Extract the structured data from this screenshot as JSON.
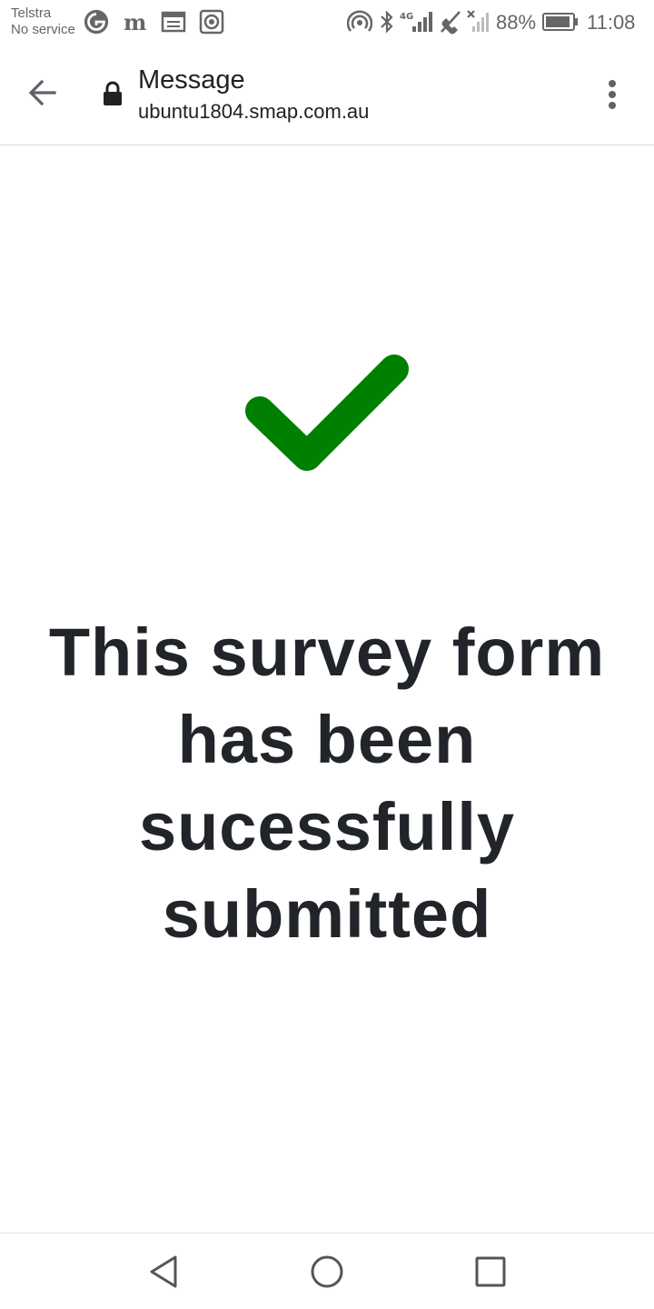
{
  "status_bar": {
    "carrier_name": "Telstra",
    "carrier_status": "No service",
    "network_type": "4G",
    "battery_percent": "88%",
    "time": "11:08",
    "icons": [
      "g-circle-icon",
      "newspaper-m-icon",
      "calendar-icon",
      "record-icon",
      "hotspot-icon",
      "bluetooth-icon",
      "signal-icon",
      "no-call-icon",
      "no-signal-icon",
      "battery-icon"
    ]
  },
  "app_bar": {
    "title": "Message",
    "url": "ubuntu1804.smap.com.au"
  },
  "content": {
    "message": "This survey form has been sucessfully submitted",
    "check_color": "#008000"
  },
  "nav_bar": {
    "buttons": [
      "back-triangle-icon",
      "home-circle-icon",
      "recents-square-icon"
    ]
  }
}
